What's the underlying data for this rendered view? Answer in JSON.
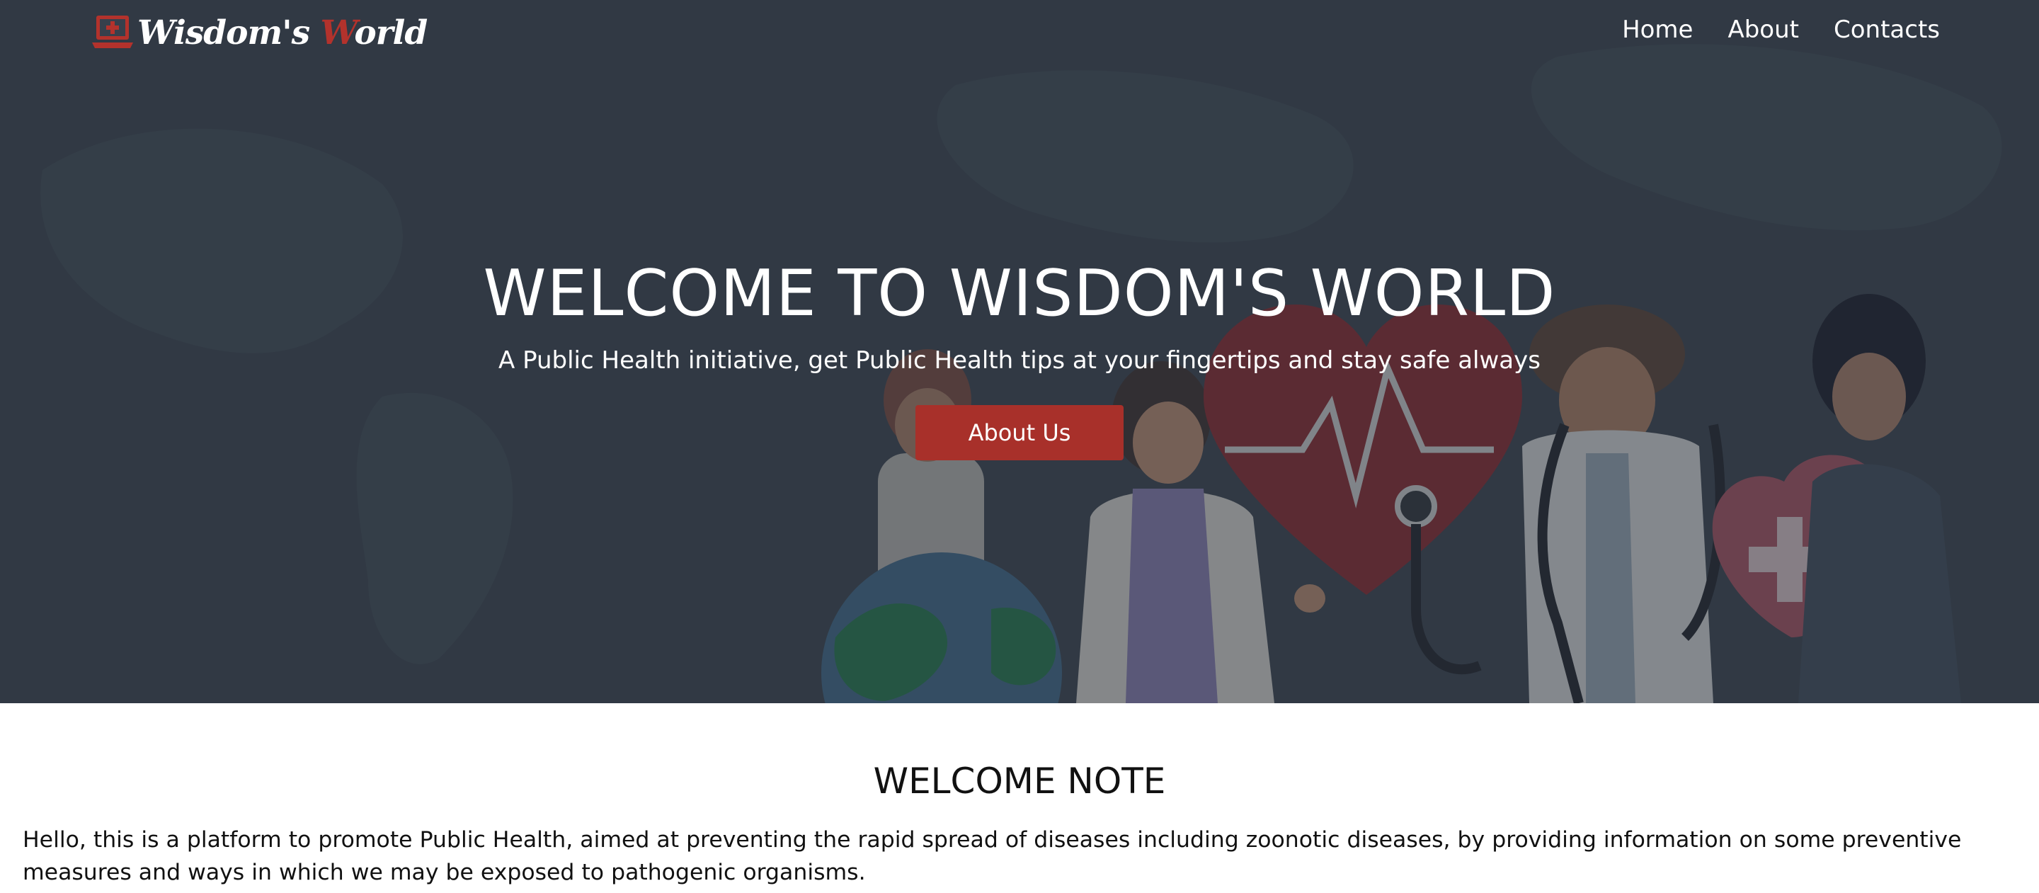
{
  "brand": {
    "name_part1": "Wisdom's ",
    "name_accent": "W",
    "name_part2": "orld",
    "icon": "laptop-medical-icon",
    "accent_color": "#b3322c"
  },
  "nav": {
    "items": [
      {
        "label": "Home"
      },
      {
        "label": "About"
      },
      {
        "label": "Contacts"
      }
    ]
  },
  "hero": {
    "title": "WELCOME TO WISDOM'S WORLD",
    "subtitle": "A Public Health initiative, get Public Health tips at your fingertips and stay safe always",
    "button_label": "About Us",
    "button_color": "#a8302a"
  },
  "welcome": {
    "title": "WELCOME NOTE",
    "text": "Hello, this is a platform to promote Public Health, aimed at preventing the rapid spread of diseases including zoonotic diseases, by providing information on some preventive measures and ways in which we may be exposed to pathogenic organisms."
  }
}
